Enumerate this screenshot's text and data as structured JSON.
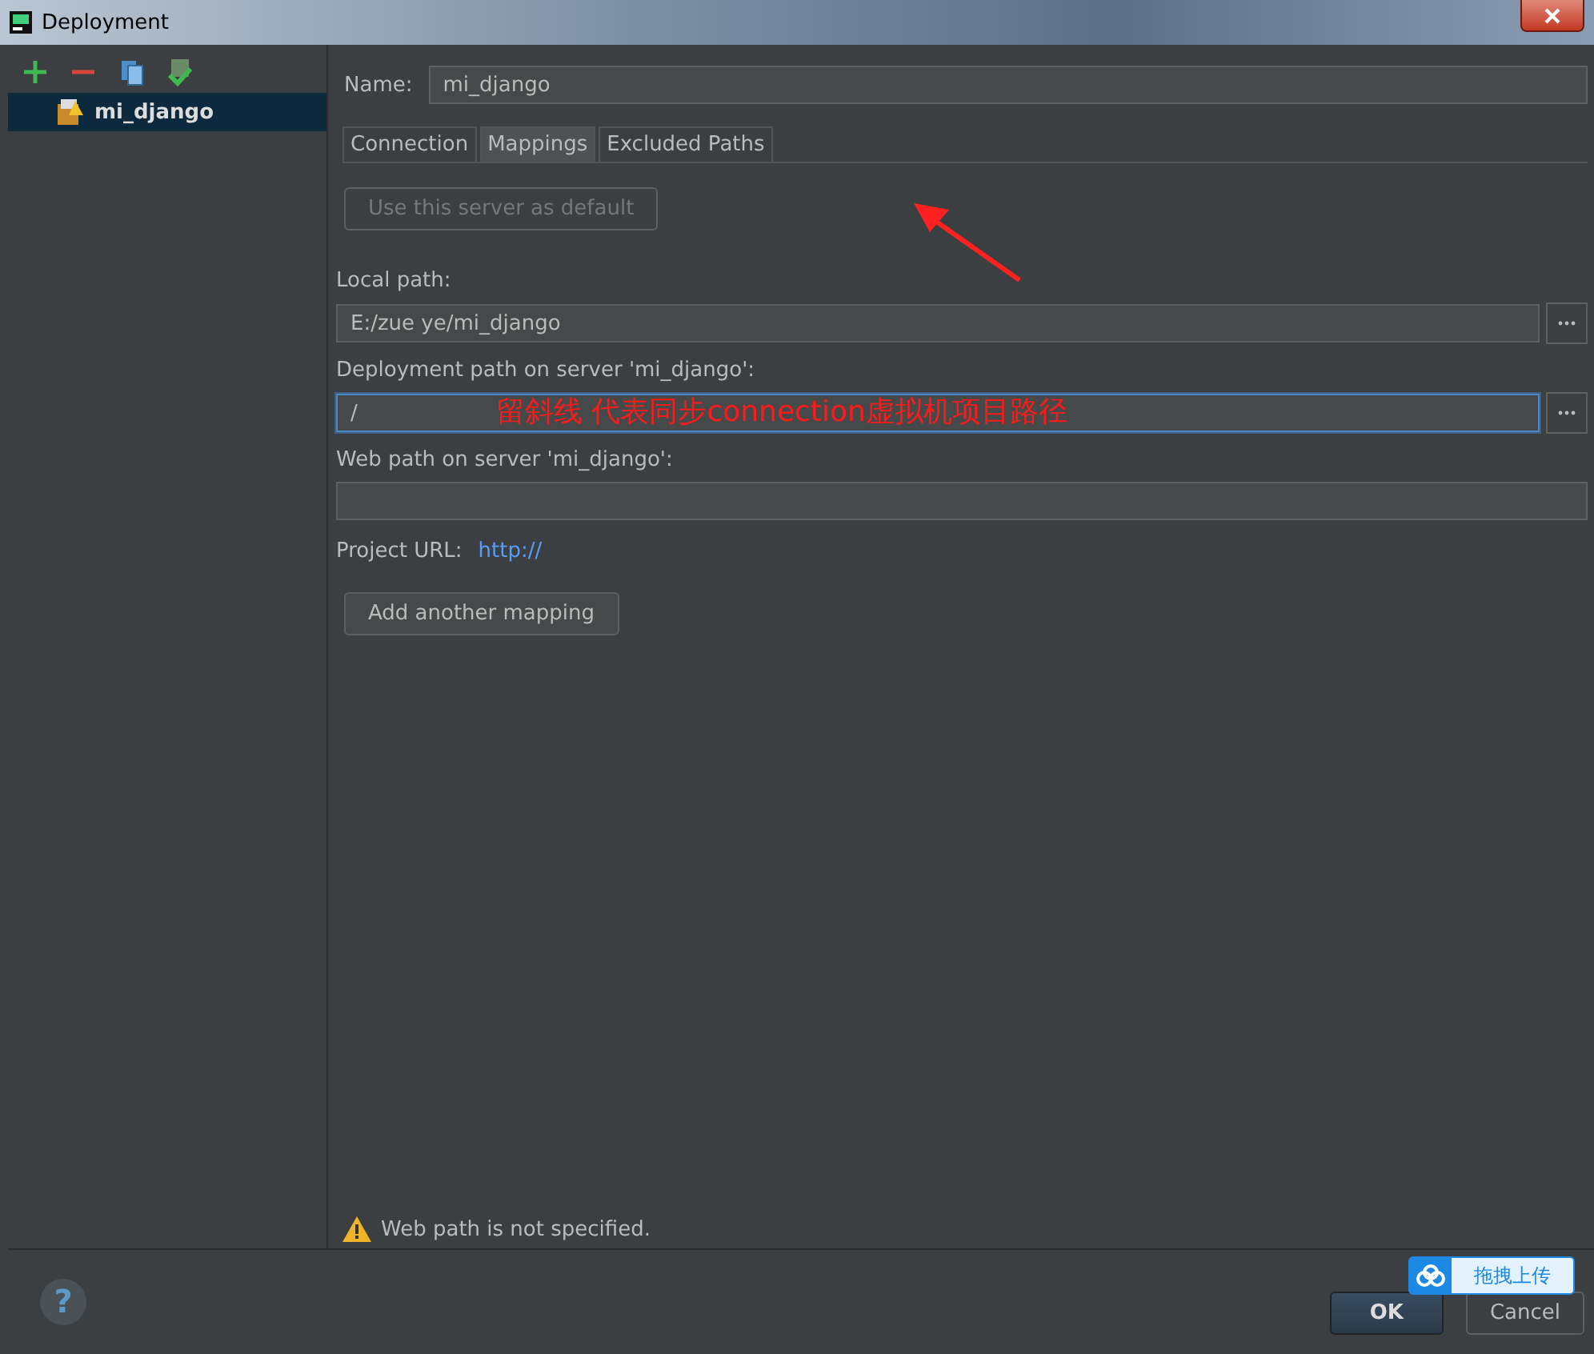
{
  "window": {
    "title": "Deployment"
  },
  "servers": [
    {
      "name": "mi_django",
      "selected": true
    }
  ],
  "name_field": {
    "label": "Name:",
    "value": "mi_django"
  },
  "tabs": [
    {
      "label": "Connection",
      "selected": false
    },
    {
      "label": "Mappings",
      "selected": true
    },
    {
      "label": "Excluded Paths",
      "selected": false
    }
  ],
  "default_button": {
    "label": "Use this server as default",
    "disabled": true
  },
  "fields": [
    {
      "label": "Local path:",
      "value": "E:/zue ye/mi_django",
      "browse": true,
      "focused": false
    },
    {
      "label": "Deployment path on server 'mi_django':",
      "value": "/",
      "browse": true,
      "focused": true
    },
    {
      "label": "Web path on server 'mi_django':",
      "browse": false,
      "focused": false
    }
  ],
  "project_url": {
    "label": "Project URL:",
    "value": "http://"
  },
  "add_button": {
    "label": "Add another mapping"
  },
  "annotation": {
    "text": "留斜线 代表同步connection虚拟机项目路径"
  },
  "warning": "Web path is not specified.",
  "help": "?",
  "buttons": [
    {
      "label": "OK",
      "kind": "default"
    },
    {
      "label": "Cancel",
      "kind": "normal"
    }
  ],
  "upload_badge": {
    "text": "拖拽上传"
  }
}
